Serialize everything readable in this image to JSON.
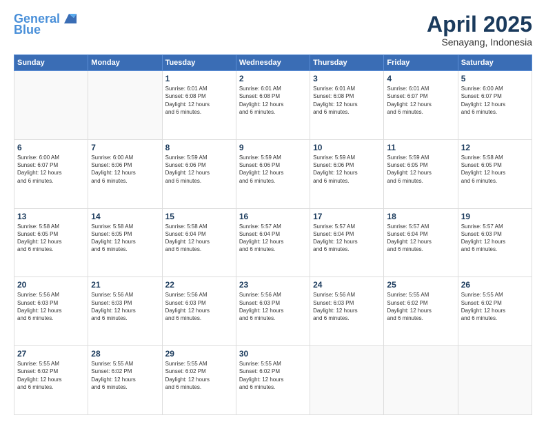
{
  "logo": {
    "line1": "General",
    "line2": "Blue"
  },
  "title": "April 2025",
  "subtitle": "Senayang, Indonesia",
  "days_of_week": [
    "Sunday",
    "Monday",
    "Tuesday",
    "Wednesday",
    "Thursday",
    "Friday",
    "Saturday"
  ],
  "weeks": [
    [
      {
        "day": "",
        "info": ""
      },
      {
        "day": "",
        "info": ""
      },
      {
        "day": "1",
        "info": "Sunrise: 6:01 AM\nSunset: 6:08 PM\nDaylight: 12 hours\nand 6 minutes."
      },
      {
        "day": "2",
        "info": "Sunrise: 6:01 AM\nSunset: 6:08 PM\nDaylight: 12 hours\nand 6 minutes."
      },
      {
        "day": "3",
        "info": "Sunrise: 6:01 AM\nSunset: 6:08 PM\nDaylight: 12 hours\nand 6 minutes."
      },
      {
        "day": "4",
        "info": "Sunrise: 6:01 AM\nSunset: 6:07 PM\nDaylight: 12 hours\nand 6 minutes."
      },
      {
        "day": "5",
        "info": "Sunrise: 6:00 AM\nSunset: 6:07 PM\nDaylight: 12 hours\nand 6 minutes."
      }
    ],
    [
      {
        "day": "6",
        "info": "Sunrise: 6:00 AM\nSunset: 6:07 PM\nDaylight: 12 hours\nand 6 minutes."
      },
      {
        "day": "7",
        "info": "Sunrise: 6:00 AM\nSunset: 6:06 PM\nDaylight: 12 hours\nand 6 minutes."
      },
      {
        "day": "8",
        "info": "Sunrise: 5:59 AM\nSunset: 6:06 PM\nDaylight: 12 hours\nand 6 minutes."
      },
      {
        "day": "9",
        "info": "Sunrise: 5:59 AM\nSunset: 6:06 PM\nDaylight: 12 hours\nand 6 minutes."
      },
      {
        "day": "10",
        "info": "Sunrise: 5:59 AM\nSunset: 6:06 PM\nDaylight: 12 hours\nand 6 minutes."
      },
      {
        "day": "11",
        "info": "Sunrise: 5:59 AM\nSunset: 6:05 PM\nDaylight: 12 hours\nand 6 minutes."
      },
      {
        "day": "12",
        "info": "Sunrise: 5:58 AM\nSunset: 6:05 PM\nDaylight: 12 hours\nand 6 minutes."
      }
    ],
    [
      {
        "day": "13",
        "info": "Sunrise: 5:58 AM\nSunset: 6:05 PM\nDaylight: 12 hours\nand 6 minutes."
      },
      {
        "day": "14",
        "info": "Sunrise: 5:58 AM\nSunset: 6:05 PM\nDaylight: 12 hours\nand 6 minutes."
      },
      {
        "day": "15",
        "info": "Sunrise: 5:58 AM\nSunset: 6:04 PM\nDaylight: 12 hours\nand 6 minutes."
      },
      {
        "day": "16",
        "info": "Sunrise: 5:57 AM\nSunset: 6:04 PM\nDaylight: 12 hours\nand 6 minutes."
      },
      {
        "day": "17",
        "info": "Sunrise: 5:57 AM\nSunset: 6:04 PM\nDaylight: 12 hours\nand 6 minutes."
      },
      {
        "day": "18",
        "info": "Sunrise: 5:57 AM\nSunset: 6:04 PM\nDaylight: 12 hours\nand 6 minutes."
      },
      {
        "day": "19",
        "info": "Sunrise: 5:57 AM\nSunset: 6:03 PM\nDaylight: 12 hours\nand 6 minutes."
      }
    ],
    [
      {
        "day": "20",
        "info": "Sunrise: 5:56 AM\nSunset: 6:03 PM\nDaylight: 12 hours\nand 6 minutes."
      },
      {
        "day": "21",
        "info": "Sunrise: 5:56 AM\nSunset: 6:03 PM\nDaylight: 12 hours\nand 6 minutes."
      },
      {
        "day": "22",
        "info": "Sunrise: 5:56 AM\nSunset: 6:03 PM\nDaylight: 12 hours\nand 6 minutes."
      },
      {
        "day": "23",
        "info": "Sunrise: 5:56 AM\nSunset: 6:03 PM\nDaylight: 12 hours\nand 6 minutes."
      },
      {
        "day": "24",
        "info": "Sunrise: 5:56 AM\nSunset: 6:03 PM\nDaylight: 12 hours\nand 6 minutes."
      },
      {
        "day": "25",
        "info": "Sunrise: 5:55 AM\nSunset: 6:02 PM\nDaylight: 12 hours\nand 6 minutes."
      },
      {
        "day": "26",
        "info": "Sunrise: 5:55 AM\nSunset: 6:02 PM\nDaylight: 12 hours\nand 6 minutes."
      }
    ],
    [
      {
        "day": "27",
        "info": "Sunrise: 5:55 AM\nSunset: 6:02 PM\nDaylight: 12 hours\nand 6 minutes."
      },
      {
        "day": "28",
        "info": "Sunrise: 5:55 AM\nSunset: 6:02 PM\nDaylight: 12 hours\nand 6 minutes."
      },
      {
        "day": "29",
        "info": "Sunrise: 5:55 AM\nSunset: 6:02 PM\nDaylight: 12 hours\nand 6 minutes."
      },
      {
        "day": "30",
        "info": "Sunrise: 5:55 AM\nSunset: 6:02 PM\nDaylight: 12 hours\nand 6 minutes."
      },
      {
        "day": "",
        "info": ""
      },
      {
        "day": "",
        "info": ""
      },
      {
        "day": "",
        "info": ""
      }
    ]
  ]
}
